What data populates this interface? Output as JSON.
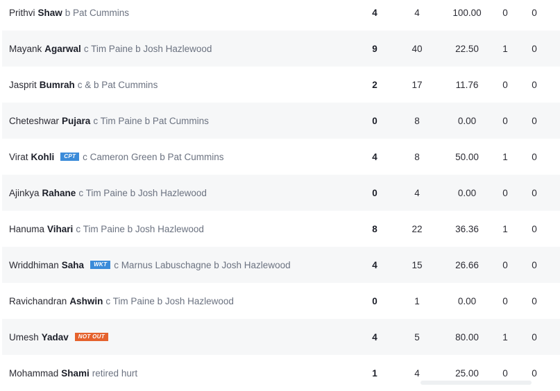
{
  "batting": [
    {
      "first": "Prithvi",
      "last": "Shaw",
      "badge": null,
      "dismissal": "b Pat Cummins",
      "runs": "4",
      "balls": "4",
      "sr": "100.00",
      "fours": "0",
      "sixes": "0"
    },
    {
      "first": "Mayank",
      "last": "Agarwal",
      "badge": null,
      "dismissal": "c Tim Paine b Josh Hazlewood",
      "runs": "9",
      "balls": "40",
      "sr": "22.50",
      "fours": "1",
      "sixes": "0"
    },
    {
      "first": "Jasprit",
      "last": "Bumrah",
      "badge": null,
      "dismissal": "c & b Pat Cummins",
      "runs": "2",
      "balls": "17",
      "sr": "11.76",
      "fours": "0",
      "sixes": "0"
    },
    {
      "first": "Cheteshwar",
      "last": "Pujara",
      "badge": null,
      "dismissal": "c Tim Paine b Pat Cummins",
      "runs": "0",
      "balls": "8",
      "sr": "0.00",
      "fours": "0",
      "sixes": "0"
    },
    {
      "first": "Virat",
      "last": "Kohli",
      "badge": "CPT",
      "badgeColor": "#3b8bd9",
      "dismissal": "c Cameron Green b Pat Cummins",
      "runs": "4",
      "balls": "8",
      "sr": "50.00",
      "fours": "1",
      "sixes": "0"
    },
    {
      "first": "Ajinkya",
      "last": "Rahane",
      "badge": null,
      "dismissal": "c Tim Paine b Josh Hazlewood",
      "runs": "0",
      "balls": "4",
      "sr": "0.00",
      "fours": "0",
      "sixes": "0"
    },
    {
      "first": "Hanuma",
      "last": "Vihari",
      "badge": null,
      "dismissal": "c Tim Paine b Josh Hazlewood",
      "runs": "8",
      "balls": "22",
      "sr": "36.36",
      "fours": "1",
      "sixes": "0"
    },
    {
      "first": "Wriddhiman",
      "last": "Saha",
      "badge": "WKT",
      "badgeColor": "#3b8bd9",
      "dismissal": "c Marnus Labuschagne b Josh Hazlewood",
      "runs": "4",
      "balls": "15",
      "sr": "26.66",
      "fours": "0",
      "sixes": "0"
    },
    {
      "first": "Ravichandran",
      "last": "Ashwin",
      "badge": null,
      "dismissal": "c Tim Paine b Josh Hazlewood",
      "runs": "0",
      "balls": "1",
      "sr": "0.00",
      "fours": "0",
      "sixes": "0"
    },
    {
      "first": "Umesh",
      "last": "Yadav",
      "badge": "NOT OUT",
      "badgeColor": "#e5622d",
      "dismissal": "",
      "runs": "4",
      "balls": "5",
      "sr": "80.00",
      "fours": "1",
      "sixes": "0"
    },
    {
      "first": "Mohammad",
      "last": "Shami",
      "badge": null,
      "dismissal": "retired hurt",
      "runs": "1",
      "balls": "4",
      "sr": "25.00",
      "fours": "0",
      "sixes": "0"
    }
  ]
}
